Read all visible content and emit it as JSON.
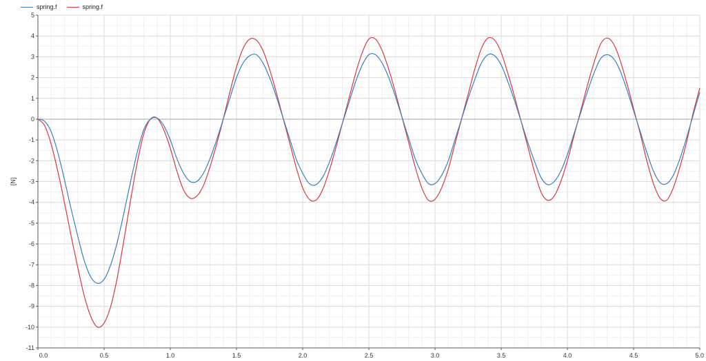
{
  "chart_data": {
    "type": "line",
    "xlabel": "",
    "ylabel": "[N]",
    "xlim": [
      0.0,
      5.0
    ],
    "ylim": [
      -11,
      5
    ],
    "x_ticks": [
      "0.0",
      "0.5",
      "1.0",
      "1.5",
      "2.0",
      "2.5",
      "3.0",
      "3.5",
      "4.0",
      "4.5",
      "5.0"
    ],
    "y_ticks": [
      "5",
      "4",
      "3",
      "2",
      "1",
      "0",
      "-1",
      "-2",
      "-3",
      "-4",
      "-5",
      "-6",
      "-7",
      "-8",
      "-9",
      "-10",
      "-11"
    ],
    "grid": true,
    "legend_position": "top-left",
    "series": [
      {
        "name": "spring.f",
        "color": "#3b7dbd",
        "points": [
          [
            0.0,
            0.0
          ],
          [
            0.05,
            -0.1
          ],
          [
            0.1,
            -0.6
          ],
          [
            0.15,
            -1.6
          ],
          [
            0.2,
            -2.9
          ],
          [
            0.25,
            -4.3
          ],
          [
            0.3,
            -5.6
          ],
          [
            0.35,
            -6.8
          ],
          [
            0.4,
            -7.6
          ],
          [
            0.45,
            -7.9
          ],
          [
            0.5,
            -7.7
          ],
          [
            0.55,
            -7.0
          ],
          [
            0.6,
            -5.9
          ],
          [
            0.65,
            -4.5
          ],
          [
            0.7,
            -3.0
          ],
          [
            0.75,
            -1.6
          ],
          [
            0.8,
            -0.5
          ],
          [
            0.85,
            0.0
          ],
          [
            0.9,
            0.05
          ],
          [
            0.95,
            -0.3
          ],
          [
            1.0,
            -1.0
          ],
          [
            1.05,
            -1.9
          ],
          [
            1.1,
            -2.6
          ],
          [
            1.15,
            -3.0
          ],
          [
            1.2,
            -3.0
          ],
          [
            1.25,
            -2.6
          ],
          [
            1.3,
            -1.9
          ],
          [
            1.35,
            -1.0
          ],
          [
            1.4,
            0.0
          ],
          [
            1.45,
            1.0
          ],
          [
            1.5,
            2.0
          ],
          [
            1.55,
            2.7
          ],
          [
            1.6,
            3.05
          ],
          [
            1.65,
            3.1
          ],
          [
            1.7,
            2.7
          ],
          [
            1.75,
            2.0
          ],
          [
            1.8,
            1.1
          ],
          [
            1.85,
            0.1
          ],
          [
            1.9,
            -0.9
          ],
          [
            1.95,
            -1.9
          ],
          [
            2.0,
            -2.6
          ],
          [
            2.05,
            -3.1
          ],
          [
            2.1,
            -3.15
          ],
          [
            2.15,
            -2.8
          ],
          [
            2.2,
            -2.1
          ],
          [
            2.25,
            -1.2
          ],
          [
            2.3,
            -0.2
          ],
          [
            2.35,
            0.8
          ],
          [
            2.4,
            1.8
          ],
          [
            2.45,
            2.6
          ],
          [
            2.5,
            3.1
          ],
          [
            2.55,
            3.1
          ],
          [
            2.6,
            2.7
          ],
          [
            2.65,
            2.0
          ],
          [
            2.7,
            1.1
          ],
          [
            2.75,
            0.1
          ],
          [
            2.8,
            -0.9
          ],
          [
            2.85,
            -1.9
          ],
          [
            2.9,
            -2.6
          ],
          [
            2.95,
            -3.1
          ],
          [
            3.0,
            -3.1
          ],
          [
            3.05,
            -2.7
          ],
          [
            3.1,
            -2.0
          ],
          [
            3.15,
            -1.0
          ],
          [
            3.2,
            0.0
          ],
          [
            3.25,
            1.0
          ],
          [
            3.3,
            1.9
          ],
          [
            3.35,
            2.7
          ],
          [
            3.4,
            3.1
          ],
          [
            3.45,
            3.05
          ],
          [
            3.5,
            2.6
          ],
          [
            3.55,
            1.8
          ],
          [
            3.6,
            0.9
          ],
          [
            3.65,
            -0.1
          ],
          [
            3.7,
            -1.1
          ],
          [
            3.75,
            -2.0
          ],
          [
            3.8,
            -2.8
          ],
          [
            3.85,
            -3.15
          ],
          [
            3.9,
            -3.0
          ],
          [
            3.95,
            -2.5
          ],
          [
            4.0,
            -1.7
          ],
          [
            4.05,
            -0.7
          ],
          [
            4.1,
            0.3
          ],
          [
            4.15,
            1.3
          ],
          [
            4.2,
            2.2
          ],
          [
            4.25,
            2.9
          ],
          [
            4.3,
            3.1
          ],
          [
            4.35,
            2.9
          ],
          [
            4.4,
            2.3
          ],
          [
            4.45,
            1.4
          ],
          [
            4.5,
            0.4
          ],
          [
            4.55,
            -0.6
          ],
          [
            4.6,
            -1.6
          ],
          [
            4.65,
            -2.5
          ],
          [
            4.7,
            -3.05
          ],
          [
            4.75,
            -3.1
          ],
          [
            4.8,
            -2.7
          ],
          [
            4.85,
            -1.9
          ],
          [
            4.9,
            -0.9
          ],
          [
            4.95,
            0.2
          ],
          [
            5.0,
            1.3
          ]
        ]
      },
      {
        "name": "spring.f",
        "color": "#d9363e",
        "points": [
          [
            0.0,
            0.0
          ],
          [
            0.05,
            -0.3
          ],
          [
            0.1,
            -1.2
          ],
          [
            0.15,
            -2.5
          ],
          [
            0.2,
            -4.0
          ],
          [
            0.25,
            -5.6
          ],
          [
            0.3,
            -7.1
          ],
          [
            0.35,
            -8.5
          ],
          [
            0.4,
            -9.5
          ],
          [
            0.45,
            -10.0
          ],
          [
            0.5,
            -9.8
          ],
          [
            0.55,
            -9.0
          ],
          [
            0.6,
            -7.6
          ],
          [
            0.65,
            -5.8
          ],
          [
            0.7,
            -3.9
          ],
          [
            0.75,
            -2.1
          ],
          [
            0.8,
            -0.7
          ],
          [
            0.85,
            0.0
          ],
          [
            0.9,
            0.05
          ],
          [
            0.95,
            -0.5
          ],
          [
            1.0,
            -1.4
          ],
          [
            1.05,
            -2.5
          ],
          [
            1.1,
            -3.4
          ],
          [
            1.15,
            -3.8
          ],
          [
            1.2,
            -3.7
          ],
          [
            1.25,
            -3.2
          ],
          [
            1.3,
            -2.3
          ],
          [
            1.35,
            -1.2
          ],
          [
            1.4,
            0.0
          ],
          [
            1.45,
            1.3
          ],
          [
            1.5,
            2.5
          ],
          [
            1.55,
            3.4
          ],
          [
            1.6,
            3.85
          ],
          [
            1.65,
            3.8
          ],
          [
            1.7,
            3.3
          ],
          [
            1.75,
            2.4
          ],
          [
            1.8,
            1.3
          ],
          [
            1.85,
            0.1
          ],
          [
            1.9,
            -1.1
          ],
          [
            1.95,
            -2.3
          ],
          [
            2.0,
            -3.3
          ],
          [
            2.05,
            -3.85
          ],
          [
            2.1,
            -3.9
          ],
          [
            2.15,
            -3.4
          ],
          [
            2.2,
            -2.5
          ],
          [
            2.25,
            -1.4
          ],
          [
            2.3,
            -0.2
          ],
          [
            2.35,
            1.0
          ],
          [
            2.4,
            2.2
          ],
          [
            2.45,
            3.2
          ],
          [
            2.5,
            3.85
          ],
          [
            2.55,
            3.85
          ],
          [
            2.6,
            3.3
          ],
          [
            2.65,
            2.4
          ],
          [
            2.7,
            1.3
          ],
          [
            2.75,
            0.1
          ],
          [
            2.8,
            -1.1
          ],
          [
            2.85,
            -2.3
          ],
          [
            2.9,
            -3.3
          ],
          [
            2.95,
            -3.9
          ],
          [
            3.0,
            -3.85
          ],
          [
            3.05,
            -3.3
          ],
          [
            3.1,
            -2.4
          ],
          [
            3.15,
            -1.2
          ],
          [
            3.2,
            0.0
          ],
          [
            3.25,
            1.2
          ],
          [
            3.3,
            2.4
          ],
          [
            3.35,
            3.4
          ],
          [
            3.4,
            3.9
          ],
          [
            3.45,
            3.8
          ],
          [
            3.5,
            3.2
          ],
          [
            3.55,
            2.2
          ],
          [
            3.6,
            1.1
          ],
          [
            3.65,
            -0.1
          ],
          [
            3.7,
            -1.3
          ],
          [
            3.75,
            -2.5
          ],
          [
            3.8,
            -3.5
          ],
          [
            3.85,
            -3.9
          ],
          [
            3.9,
            -3.7
          ],
          [
            3.95,
            -3.0
          ],
          [
            4.0,
            -2.0
          ],
          [
            4.05,
            -0.8
          ],
          [
            4.1,
            0.4
          ],
          [
            4.15,
            1.6
          ],
          [
            4.2,
            2.7
          ],
          [
            4.25,
            3.6
          ],
          [
            4.3,
            3.9
          ],
          [
            4.35,
            3.6
          ],
          [
            4.4,
            2.8
          ],
          [
            4.45,
            1.7
          ],
          [
            4.5,
            0.5
          ],
          [
            4.55,
            -0.7
          ],
          [
            4.6,
            -2.0
          ],
          [
            4.65,
            -3.1
          ],
          [
            4.7,
            -3.8
          ],
          [
            4.75,
            -3.9
          ],
          [
            4.8,
            -3.3
          ],
          [
            4.85,
            -2.3
          ],
          [
            4.9,
            -1.1
          ],
          [
            4.95,
            0.3
          ],
          [
            5.0,
            1.5
          ]
        ]
      }
    ]
  }
}
